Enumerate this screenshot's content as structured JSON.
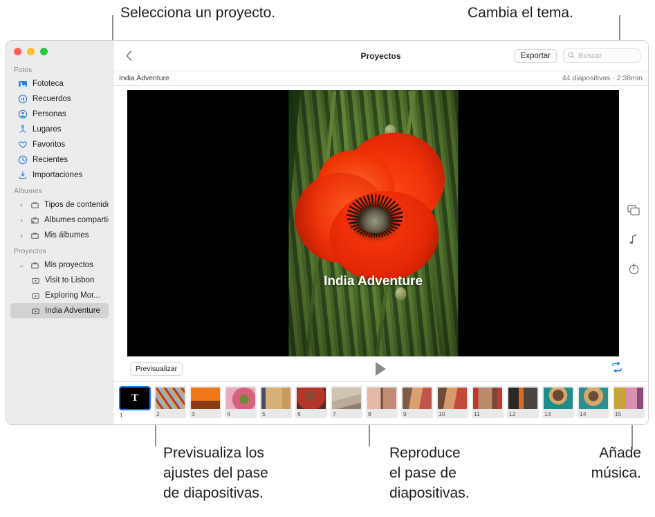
{
  "callouts": {
    "select_project": "Selecciona un proyecto.",
    "change_theme": "Cambia el tema.",
    "preview_settings": "Previsualiza los\najustes del pase\nde diapositivas.",
    "play_slideshow": "Reproduce\nel pase de\ndiapositivas.",
    "add_music": "Añade\nmúsica."
  },
  "sidebar": {
    "sections": [
      {
        "title": "Fotos",
        "items": [
          {
            "label": "Fototeca",
            "icon": "photos-library-icon"
          },
          {
            "label": "Recuerdos",
            "icon": "memories-icon"
          },
          {
            "label": "Personas",
            "icon": "people-icon"
          },
          {
            "label": "Lugares",
            "icon": "places-icon"
          },
          {
            "label": "Favoritos",
            "icon": "heart-icon"
          },
          {
            "label": "Recientes",
            "icon": "clock-icon"
          },
          {
            "label": "Importaciones",
            "icon": "import-icon"
          }
        ]
      },
      {
        "title": "Álbumes",
        "items": [
          {
            "label": "Tipos de contenido",
            "icon": "folder-icon",
            "twisty": "collapsed"
          },
          {
            "label": "Álbumes compartidos",
            "icon": "shared-folder-icon",
            "twisty": "collapsed"
          },
          {
            "label": "Mis álbumes",
            "icon": "folder-icon",
            "twisty": "collapsed"
          }
        ]
      },
      {
        "title": "Proyectos",
        "items": [
          {
            "label": "Mis proyectos",
            "icon": "folder-icon",
            "twisty": "expanded"
          },
          {
            "label": "Visit to Lisbon",
            "icon": "slideshow-icon",
            "child": true
          },
          {
            "label": "Exploring Mor...",
            "icon": "slideshow-icon",
            "child": true
          },
          {
            "label": "India Adventure",
            "icon": "slideshow-icon",
            "child": true,
            "selected": true
          }
        ]
      }
    ]
  },
  "toolbar": {
    "back_icon": "chevron-left-icon",
    "title": "Proyectos",
    "export_label": "Exportar",
    "search_icon": "search-icon",
    "search_placeholder": "Buscar",
    "search_value": ""
  },
  "infobar": {
    "project_name": "India Adventure",
    "meta": "44 diapositivas · 2:38min"
  },
  "stage": {
    "slide_title": "India Adventure"
  },
  "rail": {
    "buttons": [
      {
        "icon": "theme-cards-icon",
        "name": "theme-button"
      },
      {
        "icon": "music-note-icon",
        "name": "music-button"
      },
      {
        "icon": "duration-clock-icon",
        "name": "duration-button"
      }
    ]
  },
  "playbar": {
    "preview_label": "Previsualizar",
    "play_icon": "play-icon",
    "loop_icon": "loop-icon",
    "loop_color": "#1477ff"
  },
  "filmstrip": {
    "add_icon": "add-slide-icon",
    "slides": [
      {
        "number": "1",
        "kind": "title",
        "glyph": "T",
        "selected": true
      },
      {
        "number": "2",
        "kind": "photo",
        "c1": "#8fb4d6",
        "c2": "#d9a64a",
        "c3": "#b33a2a"
      },
      {
        "number": "3",
        "kind": "photo",
        "c1": "#f07818",
        "c2": "#e85a12",
        "c3": "#8a3b18"
      },
      {
        "number": "4",
        "kind": "photo",
        "c1": "#e8a9c0",
        "c2": "#d8607e",
        "c3": "#6f8a3c"
      },
      {
        "number": "5",
        "kind": "photo",
        "c1": "#d8b07a",
        "c2": "#c99a5e",
        "c3": "#4a4a6a"
      },
      {
        "number": "6",
        "kind": "photo",
        "c1": "#b5352a",
        "c2": "#8c4a33",
        "c3": "#5a2a20"
      },
      {
        "number": "7",
        "kind": "photo",
        "c1": "#cfc3b2",
        "c2": "#b9ab97",
        "c3": "#8e7f6c"
      },
      {
        "number": "8",
        "kind": "photo",
        "c1": "#e3b8a6",
        "c2": "#c08c74",
        "c3": "#6b4a3a"
      },
      {
        "number": "9",
        "kind": "photo",
        "c1": "#c2554a",
        "c2": "#d9a06e",
        "c3": "#7c5a44"
      },
      {
        "number": "10",
        "kind": "photo",
        "c1": "#c14a3c",
        "c2": "#d89a6a",
        "c3": "#6e4c38"
      },
      {
        "number": "11",
        "kind": "photo",
        "c1": "#c0372c",
        "c2": "#b98a6c",
        "c3": "#7a4436"
      },
      {
        "number": "12",
        "kind": "photo",
        "c1": "#4a4440",
        "c2": "#d96a2a",
        "c3": "#2a2724"
      },
      {
        "number": "13",
        "kind": "photo",
        "c1": "#1f8c8c",
        "c2": "#d8a868",
        "c3": "#6a4a32"
      },
      {
        "number": "14",
        "kind": "photo",
        "c1": "#2a8f93",
        "c2": "#d7a76a",
        "c3": "#6b4c34"
      },
      {
        "number": "15",
        "kind": "photo",
        "c1": "#c8a23a",
        "c2": "#d98fb0",
        "c3": "#8a4a78"
      }
    ]
  }
}
